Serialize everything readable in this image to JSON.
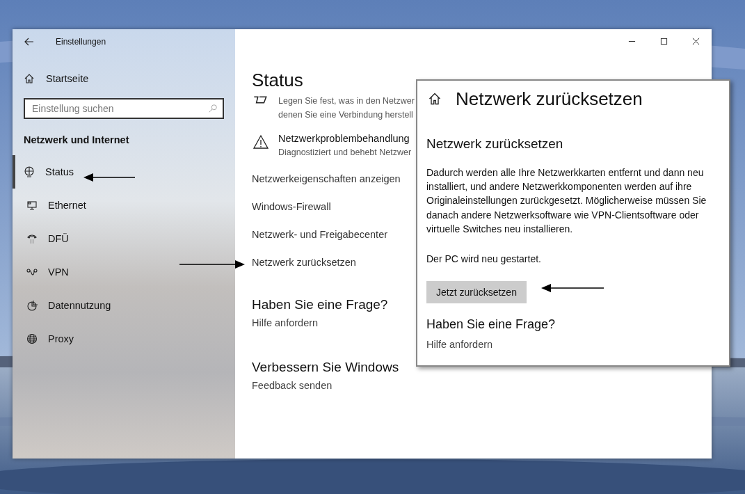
{
  "window": {
    "title": "Einstellungen"
  },
  "sidebar": {
    "home": "Startseite",
    "search": {
      "placeholder": "Einstellung suchen"
    },
    "section": "Netzwerk und Internet",
    "items": [
      {
        "label": "Status",
        "kind": "status",
        "selected": true
      },
      {
        "label": "Ethernet",
        "kind": "ethernet",
        "selected": false
      },
      {
        "label": "DFÜ",
        "kind": "dialup",
        "selected": false
      },
      {
        "label": "VPN",
        "kind": "vpn",
        "selected": false
      },
      {
        "label": "Datennutzung",
        "kind": "data",
        "selected": false
      },
      {
        "label": "Proxy",
        "kind": "proxy",
        "selected": false
      }
    ]
  },
  "content": {
    "title": "Status",
    "note": {
      "lines": [
        "Legen Sie fest, was in den Netzwer",
        "denen Sie eine Verbindung herstell"
      ]
    },
    "troubleshoot": {
      "title": "Netzwerkproblembehandlung",
      "subtitle": "Diagnostiziert und behebt Netzwer"
    },
    "links": [
      "Netzwerkeigenschaften anzeigen",
      "Windows-Firewall",
      "Netzwerk- und Freigabecenter",
      "Netzwerk zurücksetzen"
    ],
    "sections": [
      {
        "title": "Haben Sie eine Frage?",
        "link": "Hilfe anfordern"
      },
      {
        "title": "Verbessern Sie Windows",
        "link": "Feedback senden"
      }
    ]
  },
  "dialog": {
    "title": "Netzwerk zurücksetzen",
    "heading": "Netzwerk zurücksetzen",
    "body": "Dadurch werden alle Ihre Netzwerkkarten entfernt und dann neu installiert, und andere Netzwerkkomponenten werden auf ihre Originaleinstellungen zurückgesetzt. Möglicherweise müssen Sie danach andere Netzwerksoftware wie VPN-Clientsoftware oder virtuelle Switches neu installieren.",
    "note": "Der PC wird neu gestartet.",
    "button": "Jetzt zurücksetzen",
    "question": {
      "title": "Haben Sie eine Frage?",
      "link": "Hilfe anfordern"
    }
  }
}
